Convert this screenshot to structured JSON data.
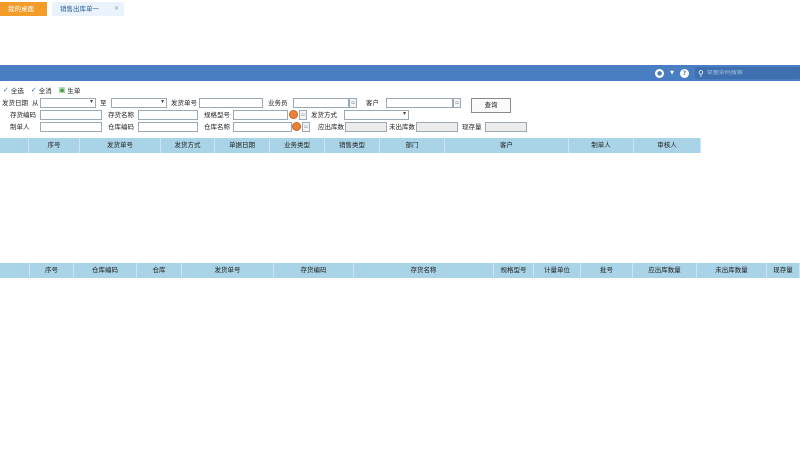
{
  "tabs": {
    "home": "我的桌面",
    "active": "销售出库单一",
    "close": "×"
  },
  "topbar": {
    "search_placeholder": "单据条码搜索"
  },
  "toolbar": {
    "select_all": "全选",
    "deselect_all": "全消",
    "generate": "生单"
  },
  "filters": {
    "ship_date": "发货日期",
    "from": "从",
    "to": "至",
    "ship_no": "发货单号",
    "salesman": "业务员",
    "customer": "客户",
    "inv_code": "存货编码",
    "inv_name": "存货名称",
    "spec": "规格型号",
    "ship_method": "发货方式",
    "maker": "制单人",
    "wh_code": "仓库编码",
    "wh_name": "仓库名称",
    "should_qty": "应出库数",
    "pending_qty": "未出库数",
    "stock_qty": "现存量",
    "query": "查询"
  },
  "top_grid": {
    "columns": [
      "序号",
      "发货单号",
      "发货方式",
      "单据日期",
      "业务类型",
      "销售类型",
      "部门",
      "客户",
      "制单人",
      "审核人"
    ]
  },
  "bottom_grid": {
    "columns": [
      "序号",
      "仓库编码",
      "仓库",
      "发货单号",
      "存货编码",
      "存货名称",
      "规格型号",
      "计量单位",
      "批号",
      "应出库数量",
      "未出库数量",
      "现存量"
    ]
  }
}
